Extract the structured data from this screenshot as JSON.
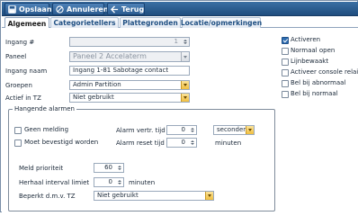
{
  "toolbar": {
    "save_label": "Opslaan",
    "cancel_label": "Annuleren",
    "back_label": "Terug"
  },
  "tabs": [
    {
      "label": "Algemeen",
      "active": true
    },
    {
      "label": "Categorietellers",
      "active": false
    },
    {
      "label": "Plattegronden",
      "active": false
    },
    {
      "label": "Locatie/opmerkingen",
      "active": false
    }
  ],
  "form": {
    "ingang_nr": {
      "label": "Ingang #",
      "value": "1"
    },
    "paneel": {
      "label": "Paneel",
      "value": "Paneel 2 Accelaterm"
    },
    "ingang_naam": {
      "label": "Ingang naam",
      "value": "Ingang 1-81 Sabotage contact"
    },
    "groepen": {
      "label": "Groepen",
      "value": "Admin Partition"
    },
    "actief_in_tz": {
      "label": "Actief in TZ",
      "value": "Niet gebruikt"
    }
  },
  "options": [
    {
      "label": "Activeren",
      "checked": true
    },
    {
      "label": "Normaal open",
      "checked": false
    },
    {
      "label": "Lijnbewaakt",
      "checked": false
    },
    {
      "label": "Activeer console relais",
      "checked": false
    },
    {
      "label": "Bel bij abnormaal",
      "checked": false
    },
    {
      "label": "Bel bij normaal",
      "checked": false
    }
  ],
  "alarms": {
    "legend": "Hangende alarmen",
    "geen_melding": {
      "label": "Geen melding",
      "checked": false
    },
    "moet_bevestigd": {
      "label": "Moet bevestigd worden",
      "checked": false
    },
    "alarm_vertr": {
      "label": "Alarm vertr. tijd",
      "value": "0",
      "unit": "seconden"
    },
    "alarm_reset": {
      "label": "Alarm reset tijd",
      "value": "0",
      "unit": "minuten"
    },
    "meld_prioriteit": {
      "label": "Meld prioriteit",
      "value": "60"
    },
    "herhaal_interval": {
      "label": "Herhaal interval limiet",
      "value": "0",
      "unit": "minuten"
    },
    "beperkt_tz": {
      "label": "Beperkt d.m.v. TZ",
      "value": "Niet gebruikt"
    }
  },
  "colors": {
    "toolbar": "#2a5b90",
    "accent": "#2f6db1",
    "select_button": "#f1bf3f"
  }
}
